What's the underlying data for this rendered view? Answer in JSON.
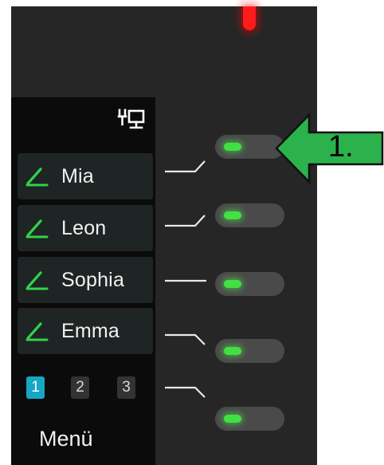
{
  "status": {
    "indicator_color": "#ff1b1b",
    "network_icon": "network-icon"
  },
  "entries": [
    {
      "label": "Mia",
      "icon": "edit-icon"
    },
    {
      "label": "Leon",
      "icon": "edit-icon"
    },
    {
      "label": "Sophia",
      "icon": "edit-icon"
    },
    {
      "label": "Emma",
      "icon": "edit-icon"
    }
  ],
  "pages": [
    "1",
    "2",
    "3"
  ],
  "active_page": "1",
  "menu_label": "Menü",
  "toggles": [
    {
      "state": "on"
    },
    {
      "state": "on"
    },
    {
      "state": "on"
    },
    {
      "state": "on"
    },
    {
      "state": "on"
    }
  ],
  "colors": {
    "accent": "#16a7c3",
    "led_on": "#43e043",
    "callout_arrow": "#2bb24c"
  },
  "callout": {
    "label": "1."
  }
}
